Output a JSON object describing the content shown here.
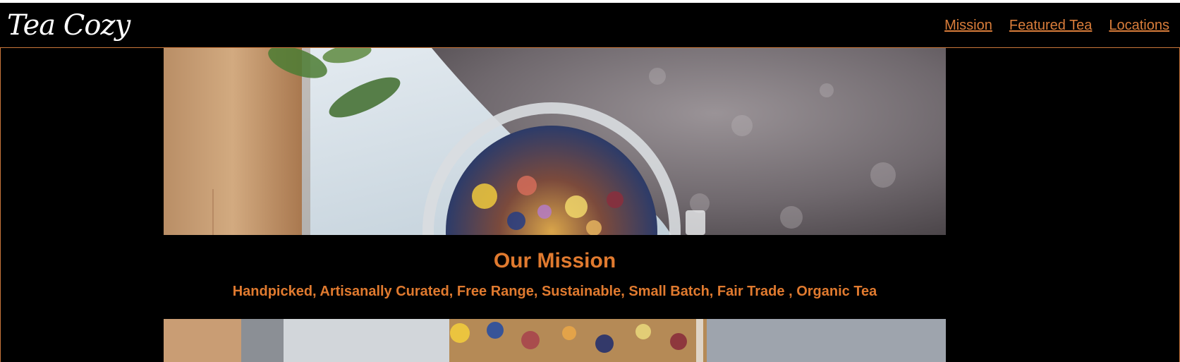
{
  "header": {
    "logo": "Tea Cozy",
    "nav": [
      {
        "label": "Mission"
      },
      {
        "label": "Featured Tea"
      },
      {
        "label": "Locations"
      }
    ]
  },
  "mission": {
    "title": "Our Mission",
    "subtitle": "Handpicked, Artisanally Curated, Free Range, Sustainable, Small Batch, Fair Trade , Organic Tea"
  },
  "colors": {
    "accent": "#e07a2f",
    "background": "#000000",
    "logo": "#ffffff"
  },
  "images": {
    "hero": "loose-leaf-tea-jar-photo",
    "bottom": "tea-jar-photo"
  }
}
